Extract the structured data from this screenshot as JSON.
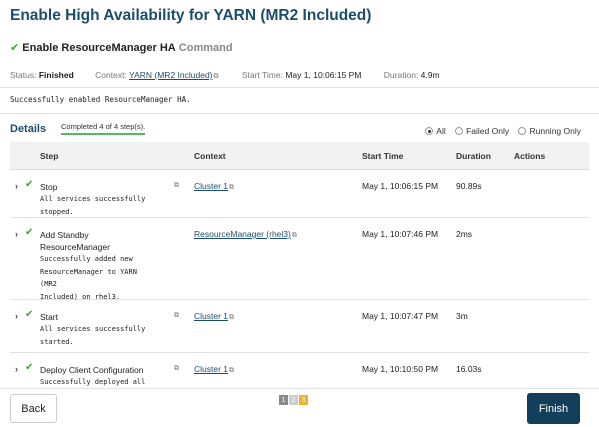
{
  "title": "Enable High Availability for YARN (MR2 Included)",
  "command": {
    "check_icon": "✔",
    "name": "Enable ResourceManager HA",
    "word": "Command"
  },
  "meta": {
    "status_label": "Status:",
    "status_value": "Finished",
    "context_label": "Context:",
    "context_value": "YARN (MR2 Included)",
    "start_label": "Start Time:",
    "start_value": "May 1, 10:06:15 PM",
    "duration_label": "Duration:",
    "duration_value": "4.9m"
  },
  "message": "Successfully enabled ResourceManager HA.",
  "details": {
    "title": "Details",
    "completed": "Completed 4 of 4 step(s).",
    "filters": [
      "All",
      "Failed Only",
      "Running Only"
    ],
    "selected_filter": "All"
  },
  "table": {
    "headers": {
      "step": "Step",
      "context": "Context",
      "start": "Start Time",
      "duration": "Duration",
      "actions": "Actions"
    },
    "rows": [
      {
        "label": "Stop",
        "msg": [
          "All services successfully",
          "stopped."
        ],
        "context": "Cluster 1",
        "start": "May 1, 10:06:15 PM",
        "duration": "90.89s"
      },
      {
        "label": "Add Standby ResourceManager",
        "msg": [
          "Successfully added new",
          "ResourceManager to YARN (MR2",
          "Included) on rhel3."
        ],
        "context": "ResourceManager (rhel3)",
        "start": "May 1, 10:07:46 PM",
        "duration": "2ms"
      },
      {
        "label": "Start",
        "msg": [
          "All services successfully",
          "started."
        ],
        "context": "Cluster 1",
        "start": "May 1, 10:07:47 PM",
        "duration": "3m"
      },
      {
        "label": "Deploy Client Configuration",
        "msg": [
          "Successfully deployed all"
        ],
        "context": "Cluster 1",
        "start": "May 1, 10:10:50 PM",
        "duration": "16.03s"
      }
    ]
  },
  "pager": [
    "1",
    "2",
    "3"
  ],
  "footer": {
    "back": "Back",
    "finish": "Finish"
  },
  "colors": {
    "title": "#1b4e6b",
    "check": "#3ea33e",
    "finish_bg": "#143f5a",
    "completed_underline": "#5cb85c"
  }
}
